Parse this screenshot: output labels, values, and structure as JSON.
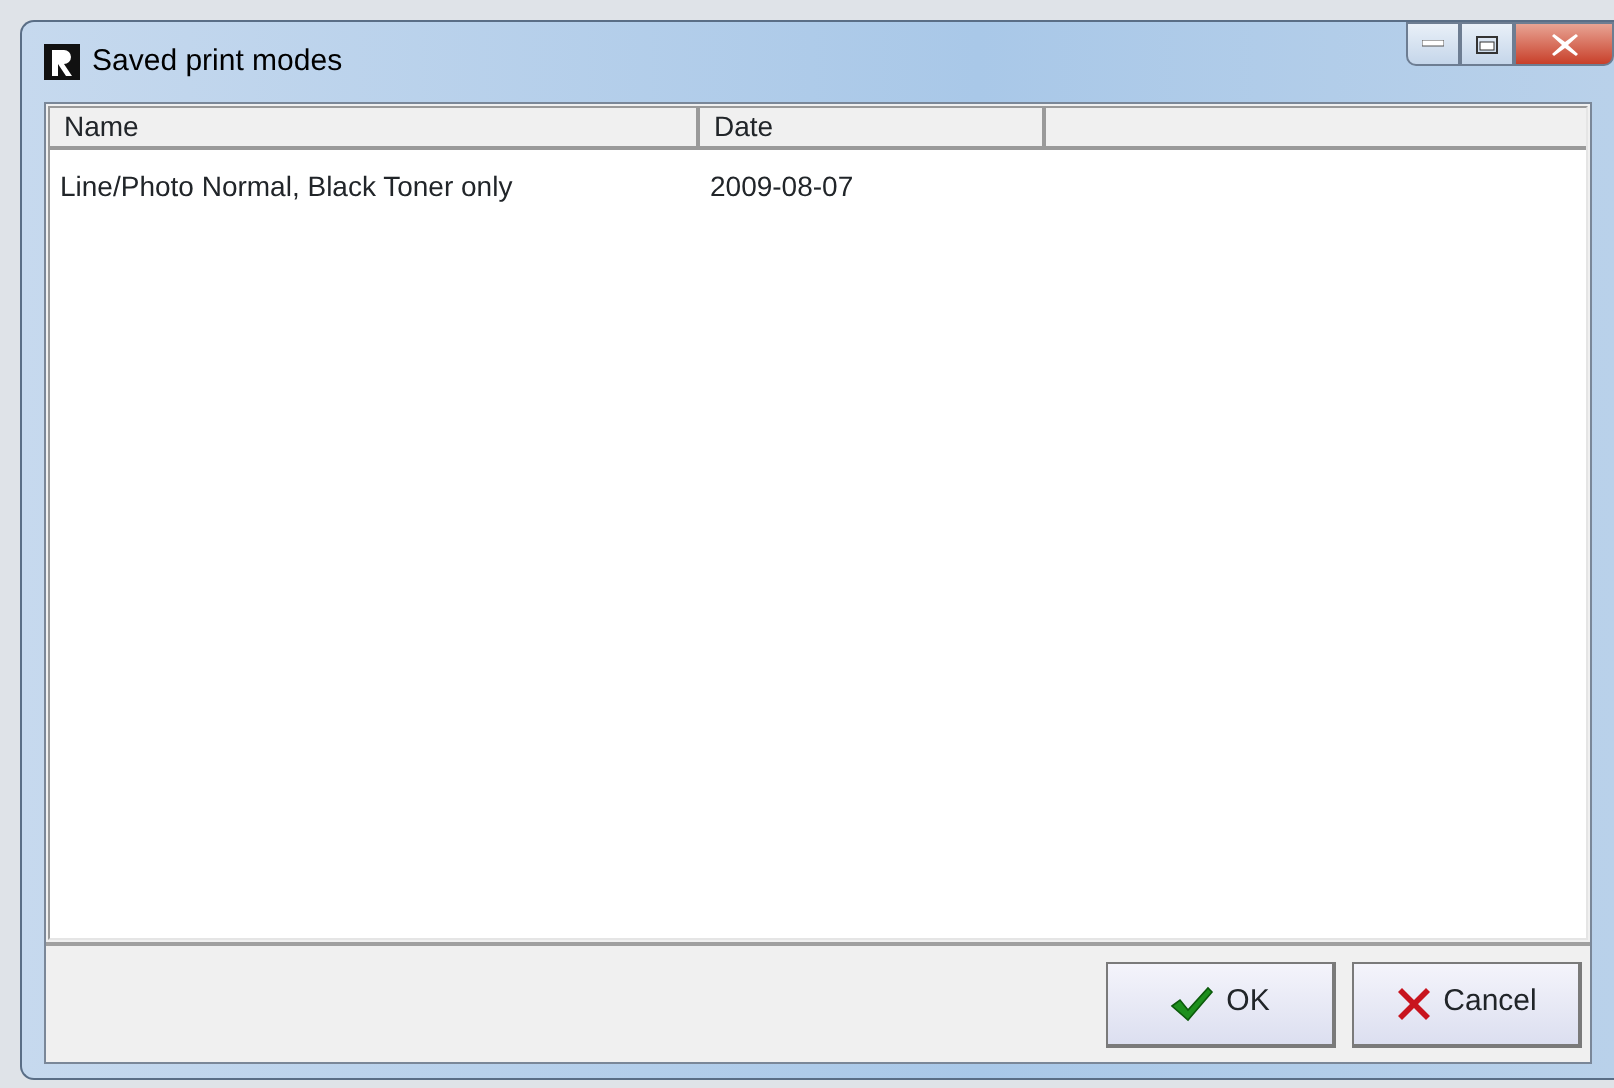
{
  "window": {
    "title": "Saved print modes"
  },
  "table": {
    "columns": [
      "Name",
      "Date"
    ],
    "rows": [
      {
        "cells": [
          "Line/Photo Normal, Black Toner only",
          "2009-08-07"
        ],
        "selected": false
      }
    ]
  },
  "buttons": [
    {
      "kind": "ok",
      "label": "OK"
    },
    {
      "kind": "cancel",
      "label": "Cancel"
    }
  ]
}
